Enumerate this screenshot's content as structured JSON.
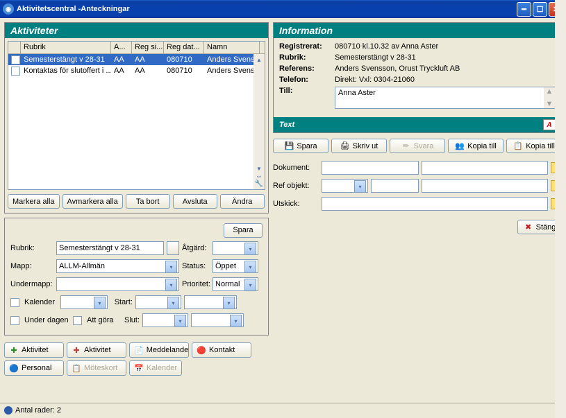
{
  "window": {
    "title": "Aktivitetscentral -Anteckningar"
  },
  "activities": {
    "header": "Aktiviteter",
    "cols": {
      "c1": "Rubrik",
      "c2": "A...",
      "c3": "Reg si...",
      "c4": "Reg dat...",
      "c5": "Namn"
    },
    "rows": [
      {
        "rubrik": "Semesterstängt v 28-31",
        "a": "AA",
        "regsi": "AA",
        "regdat": "080710",
        "namn": "Anders Svens"
      },
      {
        "rubrik": "Kontaktas för slutoffert i ...",
        "a": "AA",
        "regsi": "AA",
        "regdat": "080710",
        "namn": "Anders Svens"
      }
    ],
    "btns": {
      "markall": "Markera alla",
      "unmark": "Avmarkera alla",
      "delete": "Ta bort",
      "close": "Avsluta",
      "edit": "Ändra"
    }
  },
  "form": {
    "save": "Spara",
    "rubrik_l": "Rubrik:",
    "rubrik_v": "Semesterstängt v 28-31",
    "mapp_l": "Mapp:",
    "mapp_v": "ALLM-Allmän",
    "undermapp_l": "Undermapp:",
    "undermapp_v": "",
    "atgard_l": "Åtgärd:",
    "atgard_v": "",
    "status_l": "Status:",
    "status_v": "Öppet",
    "prio_l": "Prioritet:",
    "prio_v": "Normal",
    "kalender_l": "Kalender",
    "kalender_v": "",
    "start_l": "Start:",
    "start_v": "",
    "under_l": "Under dagen",
    "attgora_l": "Att göra",
    "slut_l": "Slut:",
    "slut_v": ""
  },
  "tools": {
    "akt_new": "Aktivitet",
    "akt_open": "Aktivitet",
    "medd": "Meddelande",
    "kontakt": "Kontakt",
    "personal": "Personal",
    "moteskort": "Möteskort",
    "kalender": "Kalender"
  },
  "info": {
    "header": "Information",
    "reg_l": "Registrerat:",
    "reg_v": "080710 kl.10.32 av Anna Aster",
    "rubrik_l": "Rubrik:",
    "rubrik_v": "Semesterstängt v 28-31",
    "ref_l": "Referens:",
    "ref_v": "Anders Svensson, Orust Tryckluft AB",
    "tel_l": "Telefon:",
    "tel_v": "Direkt:   Vxl: 0304-21060",
    "till_l": "Till:",
    "till_v": "Anna Aster"
  },
  "textpanel": {
    "header": "Text"
  },
  "rbtns": {
    "spara": "Spara",
    "skrivut": "Skriv ut",
    "svara": "Svara",
    "kopiatill": "Kopia till",
    "kopiatill2": "Kopia till"
  },
  "rform": {
    "dok_l": "Dokument:",
    "ref_l": "Ref objekt:",
    "uts_l": "Utskick:"
  },
  "close": "Stäng",
  "status": "Antal rader: 2"
}
